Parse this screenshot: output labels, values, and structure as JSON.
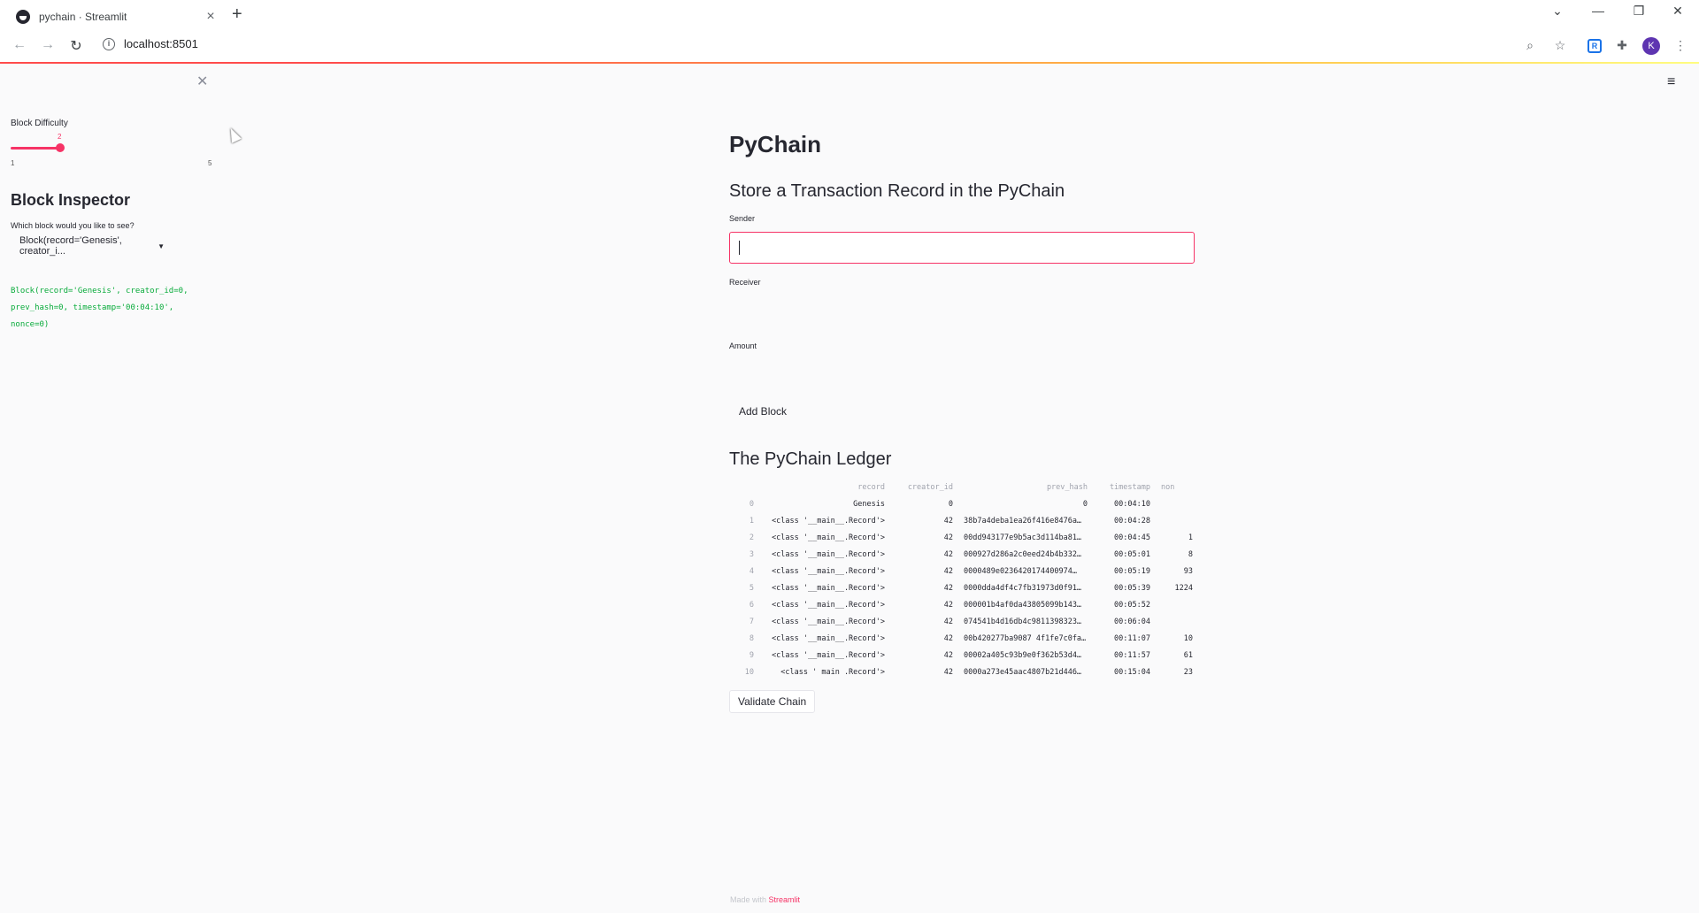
{
  "browser": {
    "tab_title": "pychain · Streamlit",
    "url": "localhost:8501",
    "profile_initial": "K",
    "extension_label": "R"
  },
  "sidebar": {
    "slider": {
      "label": "Block Difficulty",
      "value": "2",
      "min": "1",
      "max": "5",
      "fraction": 0.25
    },
    "inspector_title": "Block Inspector",
    "inspector_question": "Which block would you like to see?",
    "selected_block": "Block(record='Genesis', creator_i...",
    "block_code": "Block(record='Genesis', creator_id=0,\nprev_hash=0, timestamp='00:04:10',\nnonce=0)"
  },
  "main": {
    "title": "PyChain",
    "subtitle": "Store a Transaction Record in the PyChain",
    "sender_label": "Sender",
    "receiver_label": "Receiver",
    "amount_label": "Amount",
    "add_block_label": "Add Block",
    "ledger_title": "The PyChain Ledger",
    "validate_label": "Validate Chain"
  },
  "ledger": {
    "columns": [
      "record",
      "creator_id",
      "prev_hash",
      "timestamp",
      "non"
    ],
    "rows": [
      {
        "idx": "0",
        "record": "Genesis",
        "creator": "0",
        "prev": "0",
        "ts": "00:04:10",
        "nonce": ""
      },
      {
        "idx": "1",
        "record": "<class '__main__.Record'>",
        "creator": "42",
        "prev": "38b7a4deba1ea26f416e8476a…",
        "ts": "00:04:28",
        "nonce": ""
      },
      {
        "idx": "2",
        "record": "<class '__main__.Record'>",
        "creator": "42",
        "prev": "00dd943177e9b5ac3d114ba81…",
        "ts": "00:04:45",
        "nonce": "1"
      },
      {
        "idx": "3",
        "record": "<class '__main__.Record'>",
        "creator": "42",
        "prev": "000927d286a2c0eed24b4b332…",
        "ts": "00:05:01",
        "nonce": "8"
      },
      {
        "idx": "4",
        "record": "<class '__main__.Record'>",
        "creator": "42",
        "prev": "0000489e0236420174400974…",
        "ts": "00:05:19",
        "nonce": "93"
      },
      {
        "idx": "5",
        "record": "<class '__main__.Record'>",
        "creator": "42",
        "prev": "0000dda4df4c7fb31973d0f91…",
        "ts": "00:05:39",
        "nonce": "1224"
      },
      {
        "idx": "6",
        "record": "<class '__main__.Record'>",
        "creator": "42",
        "prev": "000001b4af0da43805099b143…",
        "ts": "00:05:52",
        "nonce": ""
      },
      {
        "idx": "7",
        "record": "<class '__main__.Record'>",
        "creator": "42",
        "prev": "074541b4d16db4c9811398323…",
        "ts": "00:06:04",
        "nonce": ""
      },
      {
        "idx": "8",
        "record": "<class '__main__.Record'>",
        "creator": "42",
        "prev": "00b420277ba9087 4f1fe7c0fa…",
        "ts": "00:11:07",
        "nonce": "10"
      },
      {
        "idx": "9",
        "record": "<class '__main__.Record'>",
        "creator": "42",
        "prev": "00002a405c93b9e0f362b53d4…",
        "ts": "00:11:57",
        "nonce": "61"
      },
      {
        "idx": "10",
        "record": "<class '  main  .Record'>",
        "creator": "42",
        "prev": "0000a273e45aac4807b21d446…",
        "ts": "00:15:04",
        "nonce": "23"
      }
    ]
  },
  "footer": {
    "made_with": "Made with",
    "brand": "Streamlit"
  },
  "colors": {
    "accent": "#f63366",
    "code_green": "#09ab3b"
  }
}
